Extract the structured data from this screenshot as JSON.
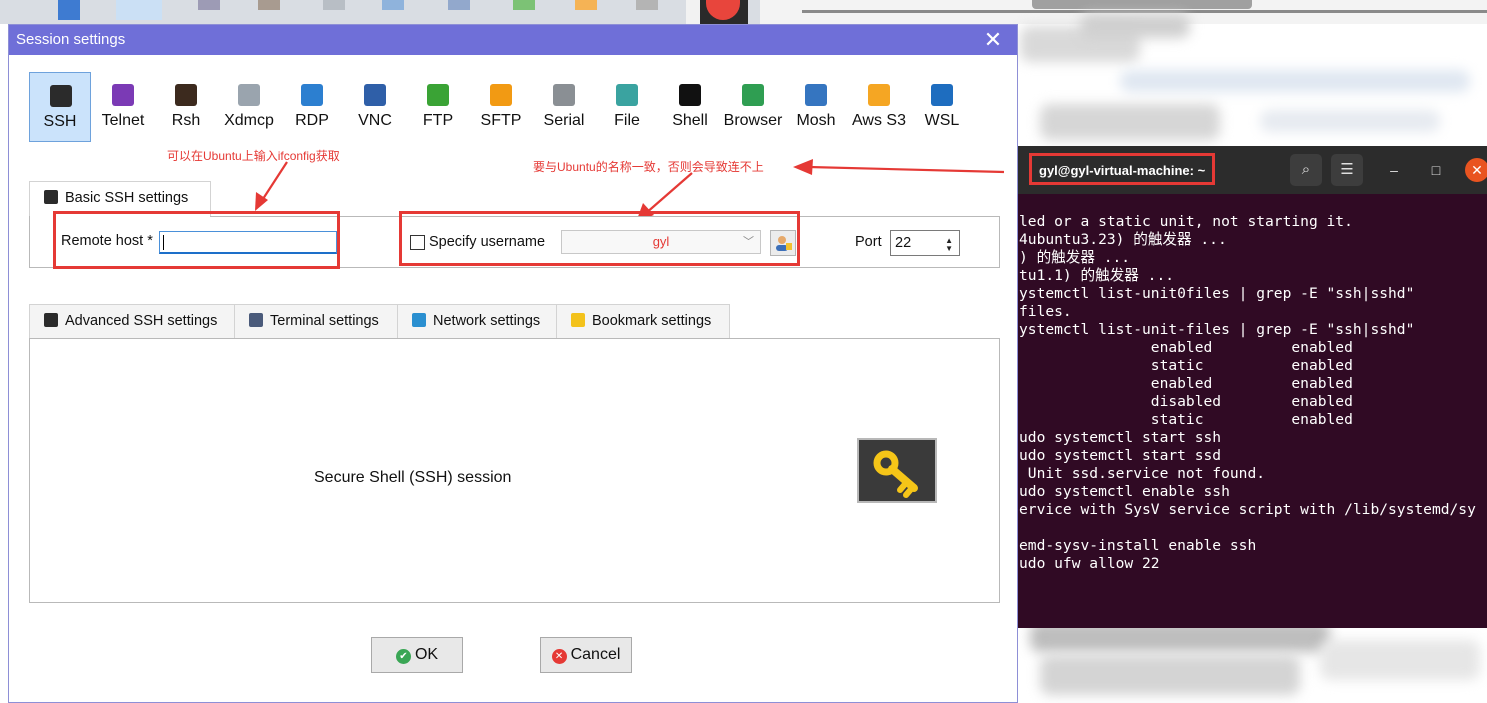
{
  "dialog": {
    "title": "Session settings",
    "close_glyph": "✕",
    "session_types": [
      {
        "label": "SSH",
        "icon": "ssh-key-icon",
        "color": "#2b2b2b",
        "selected": true
      },
      {
        "label": "Telnet",
        "icon": "telnet-icon",
        "color": "#7b3ab5"
      },
      {
        "label": "Rsh",
        "icon": "rsh-icon",
        "color": "#3c2a1e"
      },
      {
        "label": "Xdmcp",
        "icon": "xdmcp-icon",
        "color": "#9aa4ae"
      },
      {
        "label": "RDP",
        "icon": "rdp-icon",
        "color": "#2c7fd0"
      },
      {
        "label": "VNC",
        "icon": "vnc-icon",
        "color": "#2f5fa8"
      },
      {
        "label": "FTP",
        "icon": "ftp-icon",
        "color": "#3aa335"
      },
      {
        "label": "SFTP",
        "icon": "sftp-icon",
        "color": "#f29a13"
      },
      {
        "label": "Serial",
        "icon": "serial-icon",
        "color": "#8a8f94"
      },
      {
        "label": "File",
        "icon": "file-icon",
        "color": "#3aa3a0"
      },
      {
        "label": "Shell",
        "icon": "shell-icon",
        "color": "#111111"
      },
      {
        "label": "Browser",
        "icon": "browser-globe-icon",
        "color": "#2f9e52"
      },
      {
        "label": "Mosh",
        "icon": "mosh-icon",
        "color": "#3575c0"
      },
      {
        "label": "Aws S3",
        "icon": "aws-s3-icon",
        "color": "#f5a623"
      },
      {
        "label": "WSL",
        "icon": "wsl-icon",
        "color": "#1e6dbf"
      }
    ],
    "annotations": {
      "host_hint": "可以在Ubuntu上输入ifconfig获取",
      "username_hint": "要与Ubuntu的名称一致，否则会导致连不上"
    },
    "basic_tab": {
      "label": "Basic SSH settings"
    },
    "remote_host": {
      "label": "Remote host *",
      "value": ""
    },
    "specify_username": {
      "label": "Specify username",
      "checked": false,
      "value": "gyl"
    },
    "port": {
      "label": "Port",
      "value": "22"
    },
    "advanced_tabs": [
      {
        "label": "Advanced SSH settings",
        "icon": "ssh-key-icon",
        "color": "#2b2b2b"
      },
      {
        "label": "Terminal settings",
        "icon": "terminal-icon",
        "color": "#4a5a7a"
      },
      {
        "label": "Network settings",
        "icon": "network-icon",
        "color": "#2a8fd0"
      },
      {
        "label": "Bookmark settings",
        "icon": "star-icon",
        "color": "#f3c21b"
      }
    ],
    "session_description": "Secure Shell (SSH) session",
    "buttons": {
      "ok": "OK",
      "cancel": "Cancel"
    }
  },
  "terminal": {
    "title": "gyl@gyl-virtual-machine: ~",
    "lines": [
      "led or a static unit, not starting it.",
      "4ubuntu3.23) 的触发器 ...",
      ") 的触发器 ...",
      "tu1.1) 的触发器 ...",
      "ystemctl list-unit0files | grep -E \"ssh|sshd\"",
      "files.",
      "ystemctl list-unit-files | grep -E \"ssh|sshd\"",
      "               enabled         enabled",
      "               static          enabled",
      "               enabled         enabled",
      "               disabled        enabled",
      "               static          enabled",
      "udo systemctl start ssh",
      "udo systemctl start ssd",
      " Unit ssd.service not found.",
      "udo systemctl enable ssh",
      "ervice with SysV service script with /lib/systemd/sy",
      "",
      "emd-sysv-install enable ssh",
      "udo ufw allow 22"
    ]
  }
}
